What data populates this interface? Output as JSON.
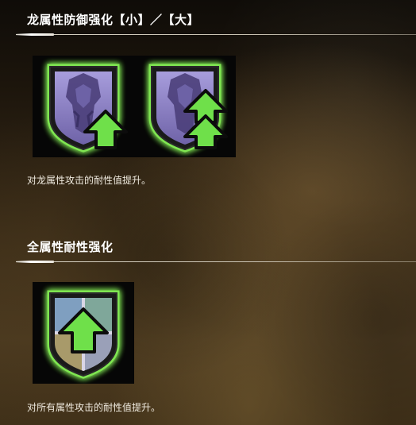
{
  "sections": [
    {
      "title": "龙属性防御强化【小】／【大】",
      "icons": [
        {
          "name": "dragon-resistance-small-icon",
          "arrow_count": 1
        },
        {
          "name": "dragon-resistance-large-icon",
          "arrow_count": 2
        }
      ],
      "description": "对龙属性攻击的耐性值提升。"
    },
    {
      "title": "全属性耐性强化",
      "icons": [
        {
          "name": "all-resistance-up-icon",
          "arrow_count": 1
        }
      ],
      "description": "对所有属性攻击的耐性值提升。"
    }
  ],
  "colors": {
    "arrow_green": "#6fe04a",
    "glow_green": "#8dff5a",
    "shield_purple": "#8d82c8",
    "shield_blue": "#7f9fc0",
    "shield_teal": "#7fa79a",
    "shield_tan": "#a89a6a"
  }
}
